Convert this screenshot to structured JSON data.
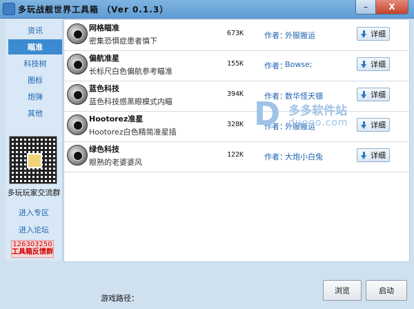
{
  "window": {
    "title": "多玩战舰世界工具箱 （Ver 0.1.3）",
    "minimize_label": "–",
    "close_label": "X"
  },
  "sidebar": {
    "items": [
      {
        "label": "资讯"
      },
      {
        "label": "瞄准"
      },
      {
        "label": "科技树"
      },
      {
        "label": "图标"
      },
      {
        "label": "炮弹"
      },
      {
        "label": "其他"
      }
    ],
    "active_index": 1,
    "qq_group_label": "多玩玩家交流群",
    "enter_zone": "进入专区",
    "enter_forum": "进入论坛",
    "feedback_number": "126303250",
    "feedback_label": "工具箱反馈群"
  },
  "mods": {
    "author_label": "作者：",
    "detail_label": "详细",
    "items": [
      {
        "name": "网格瞄准",
        "desc": "密集恐惧症患者慎下",
        "size": "673K",
        "author": "外服搬运"
      },
      {
        "name": "偏航准星",
        "desc": "长标尺白色偏航参考瞄准",
        "size": "155K",
        "author": "Bowse;"
      },
      {
        "name": "蓝色科技",
        "desc": "蓝色科技感黑眼模式内瞄",
        "size": "394K",
        "author": "数华怪天钿"
      },
      {
        "name": "Hootorez准星",
        "desc": "Hootorez白色精简准星插",
        "size": "328K",
        "author": "外服搬运"
      },
      {
        "name": "绿色科技",
        "desc": "眼熟的老婆婆风",
        "size": "122K",
        "author": "大炮小白兔"
      }
    ]
  },
  "watermark": {
    "letter": "D",
    "text": "多多软件站",
    "url": "duooo.com"
  },
  "footer": {
    "path_label": "游戏路径：",
    "browse_label": "浏览",
    "launch_label": "启动"
  },
  "colors": {
    "accent": "#3c8ad0",
    "link": "#1b63b0",
    "panel_bg": "#cfe0ef"
  }
}
